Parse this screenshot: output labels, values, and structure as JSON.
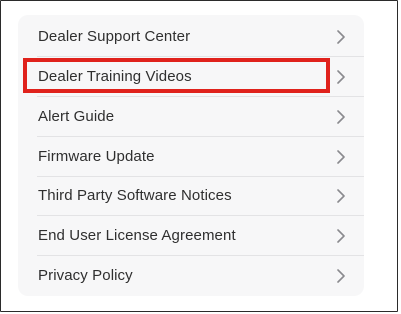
{
  "menu": {
    "items": [
      {
        "label": "Dealer Support Center",
        "chevron": "chevron-right-icon"
      },
      {
        "label": "Dealer Training Videos",
        "chevron": "chevron-right-icon",
        "highlighted": true
      },
      {
        "label": "Alert Guide",
        "chevron": "chevron-right-icon"
      },
      {
        "label": "Firmware Update",
        "chevron": "chevron-right-icon"
      },
      {
        "label": "Third Party Software Notices",
        "chevron": "chevron-right-icon"
      },
      {
        "label": "End User License Agreement",
        "chevron": "chevron-right-icon"
      },
      {
        "label": "Privacy Policy",
        "chevron": "chevron-right-icon"
      }
    ]
  },
  "colors": {
    "panel_background": "#f7f7f8",
    "text": "#2f2f2f",
    "chevron": "#8a8a8e",
    "divider": "#e3e3e5",
    "highlight_border": "#e0221c"
  }
}
